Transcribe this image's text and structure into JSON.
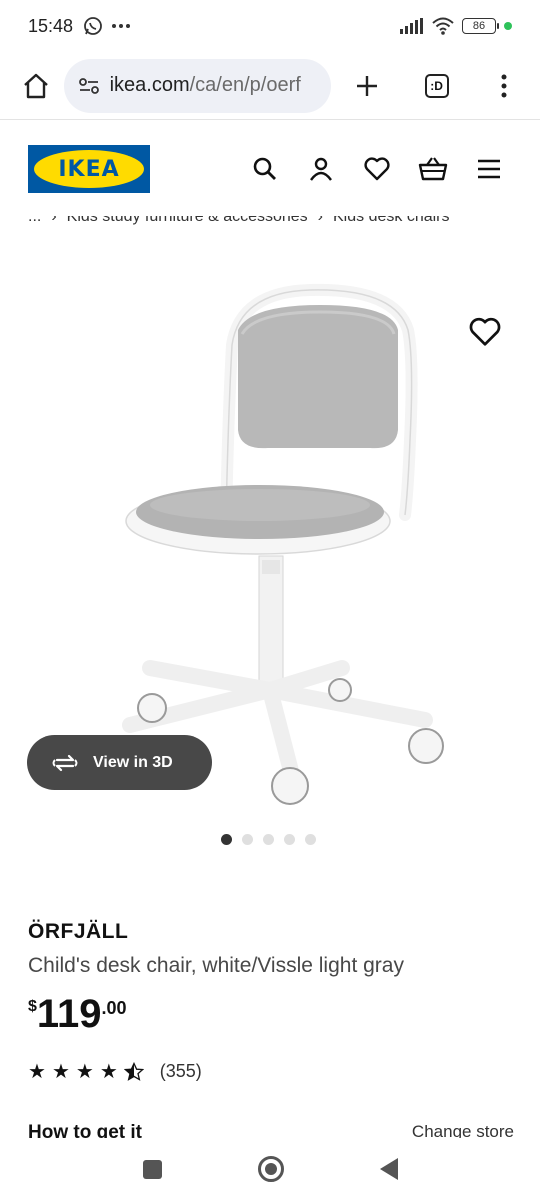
{
  "status_bar": {
    "time": "15:48",
    "battery": "86"
  },
  "browser": {
    "url_host": "ikea.com",
    "url_path": "/ca/en/p/oerf",
    "tab_icon_text": ":D"
  },
  "breadcrumb": {
    "ellipsis": "...",
    "items": [
      "Kids study furniture & accessories",
      "Kids desk chairs"
    ],
    "separator": "›"
  },
  "logo_text": "IKEA",
  "product": {
    "view_3d_label": "View in 3D",
    "name": "ÖRFJÄLL",
    "description": "Child's desk chair, white/Vissle light gray",
    "price_currency": "$",
    "price_whole": "119",
    "price_cents": ".00",
    "rating_value": 4.5,
    "rating_count": "(355)",
    "image_count": 5,
    "active_image": 1
  },
  "fulfilment": {
    "heading": "How to get it",
    "change_store": "Change store"
  },
  "colors": {
    "ikea_blue": "#0058a3",
    "ikea_yellow": "#ffdb00",
    "view3d_bg": "#484848"
  }
}
